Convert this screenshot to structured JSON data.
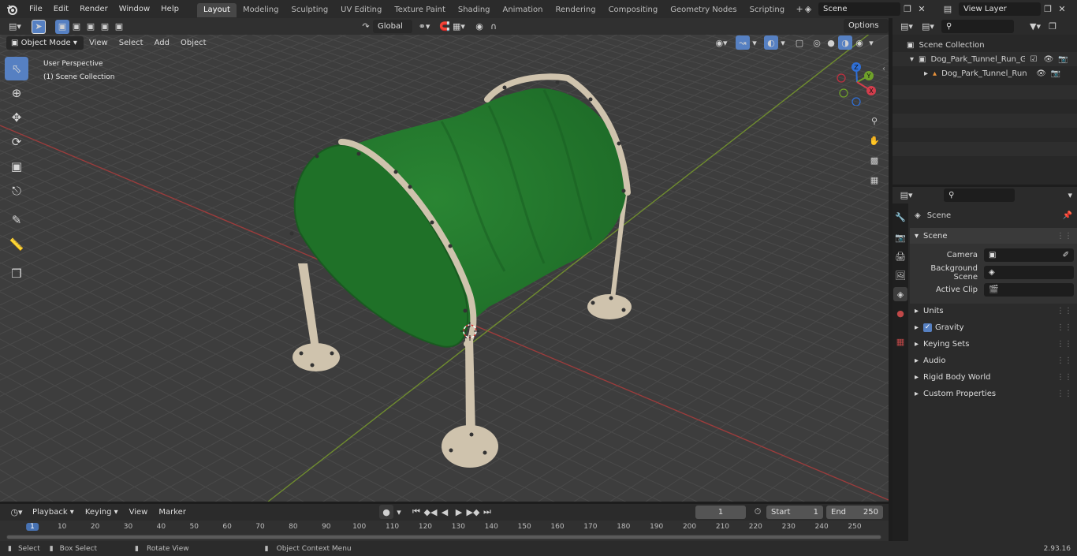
{
  "menu": [
    "File",
    "Edit",
    "Render",
    "Window",
    "Help"
  ],
  "workspaces": [
    "Layout",
    "Modeling",
    "Sculpting",
    "UV Editing",
    "Texture Paint",
    "Shading",
    "Animation",
    "Rendering",
    "Compositing",
    "Geometry Nodes",
    "Scripting"
  ],
  "active_workspace": "Layout",
  "scene_name": "Scene",
  "view_layer": "View Layer",
  "header": {
    "transform_orientation": "Global",
    "options_label": "Options"
  },
  "vp_header": {
    "mode": "Object Mode",
    "view": "View",
    "select": "Select",
    "add": "Add",
    "object": "Object"
  },
  "viewport": {
    "perspective": "User Perspective",
    "collection": "(1) Scene Collection",
    "gizmo": {
      "x": "X",
      "y": "Y",
      "z": "Z"
    }
  },
  "outliner": {
    "root": "Scene Collection",
    "items": [
      {
        "name": "Dog_Park_Tunnel_Run_Green",
        "level": 1
      },
      {
        "name": "Dog_Park_Tunnel_Run_G",
        "level": 2
      }
    ]
  },
  "properties": {
    "context": "Scene",
    "section": "Scene",
    "fields": [
      {
        "label": "Camera",
        "value": ""
      },
      {
        "label": "Background Scene",
        "value": ""
      },
      {
        "label": "Active Clip",
        "value": ""
      }
    ],
    "panels": [
      "Units",
      "Gravity",
      "Keying Sets",
      "Audio",
      "Rigid Body World",
      "Custom Properties"
    ]
  },
  "timeline": {
    "menus": [
      "Playback",
      "Keying",
      "View",
      "Marker"
    ],
    "current_frame": "1",
    "start_label": "Start",
    "start": "1",
    "end_label": "End",
    "end": "250",
    "ticks": [
      "1",
      "10",
      "20",
      "30",
      "40",
      "50",
      "60",
      "70",
      "80",
      "90",
      "100",
      "110",
      "120",
      "130",
      "140",
      "150",
      "160",
      "170",
      "180",
      "190",
      "200",
      "210",
      "220",
      "230",
      "240",
      "250"
    ]
  },
  "status": {
    "select": "Select",
    "box_select": "Box Select",
    "rotate_view": "Rotate View",
    "context_menu": "Object Context Menu",
    "version": "2.93.16"
  },
  "colors": {
    "accent": "#5680c2",
    "tunnel_green": "#2e7a34",
    "frame_beige": "#cfc3ad",
    "grid_bg": "#3d3d3d"
  }
}
